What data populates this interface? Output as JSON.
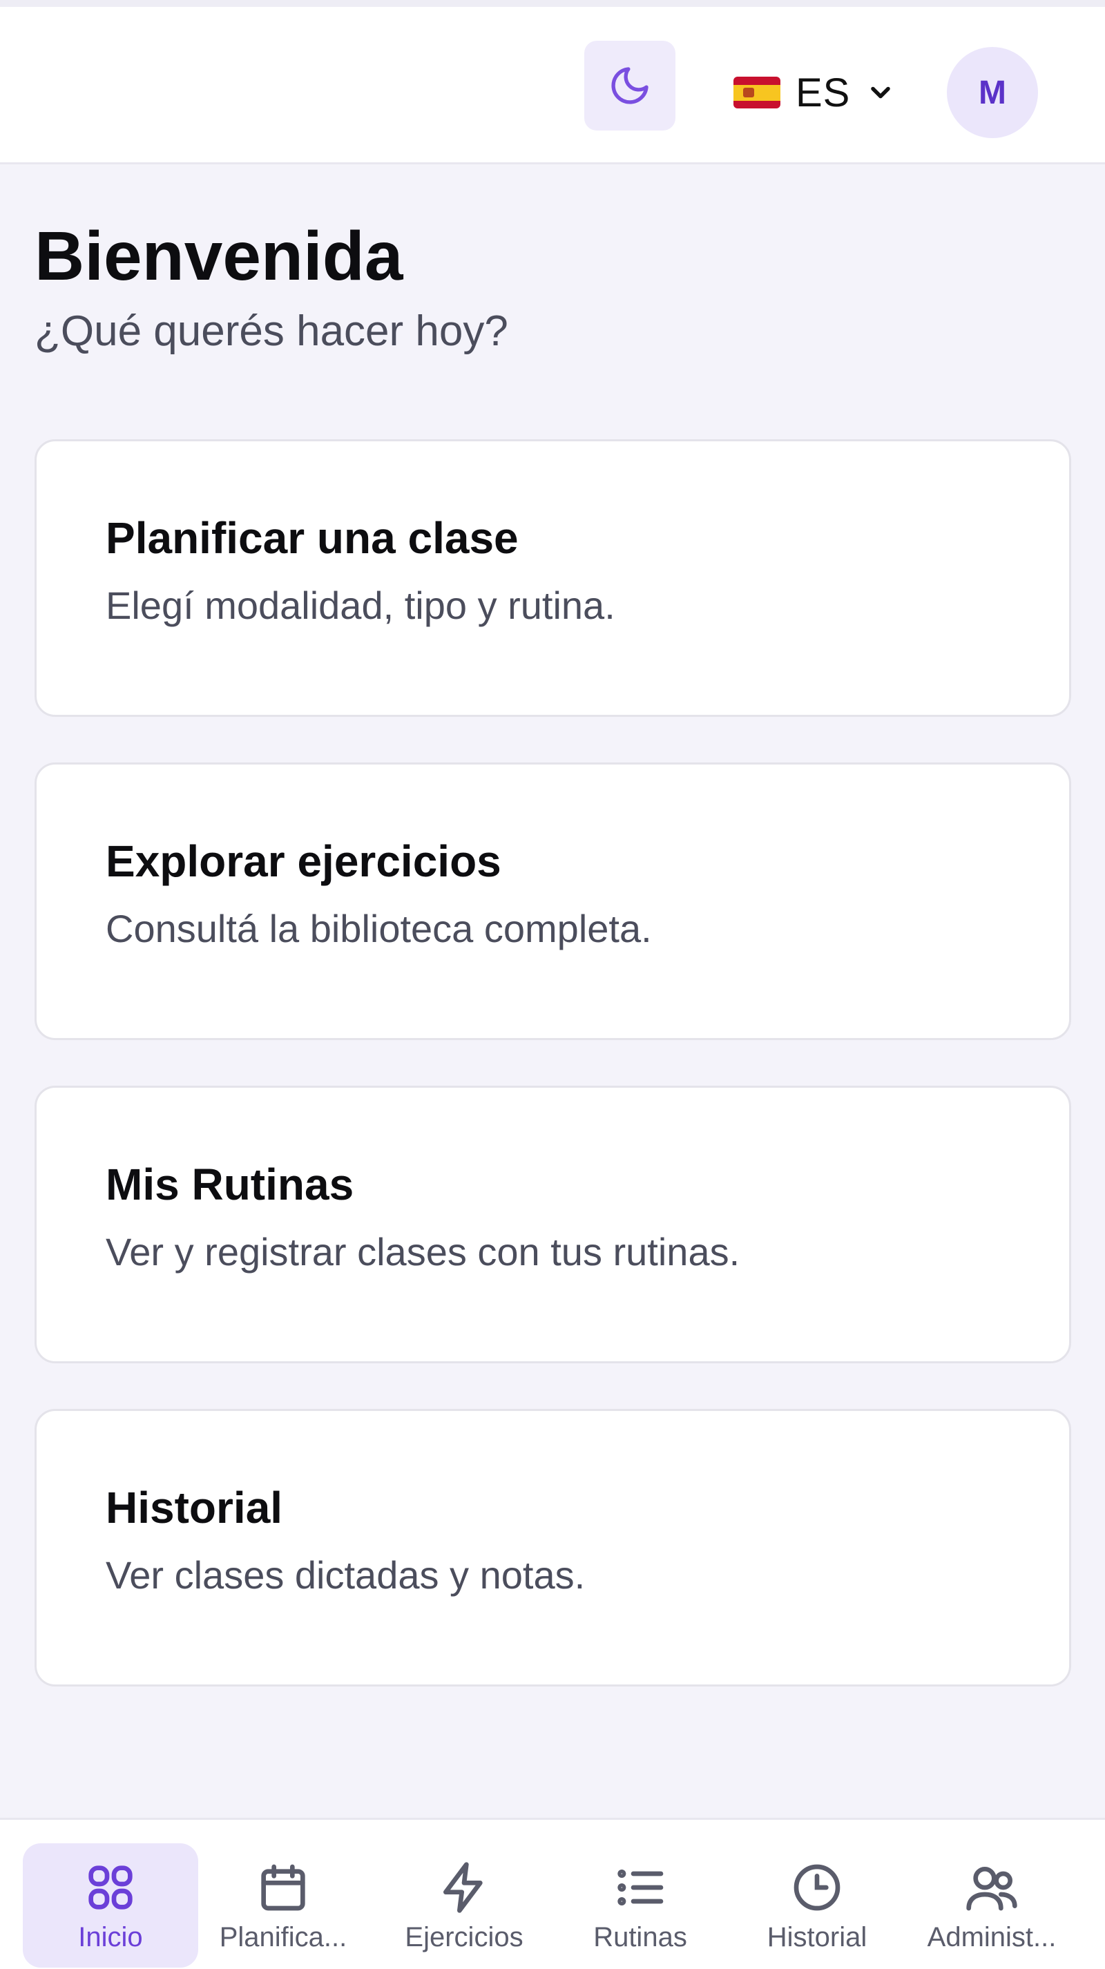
{
  "header": {
    "theme_toggle_icon": "moon-icon",
    "language": {
      "flag_icon": "spain-flag-icon",
      "code": "ES",
      "chevron_icon": "chevron-down-icon"
    },
    "avatar_initial": "M"
  },
  "greeting": {
    "title": "Bienvenida",
    "subtitle": "¿Qué querés hacer hoy?"
  },
  "cards": [
    {
      "title": "Planificar una clase",
      "description": "Elegí modalidad, tipo y rutina."
    },
    {
      "title": "Explorar ejercicios",
      "description": "Consultá la biblioteca completa."
    },
    {
      "title": "Mis Rutinas",
      "description": "Ver y registrar clases con tus rutinas."
    },
    {
      "title": "Historial",
      "description": "Ver clases dictadas y notas."
    }
  ],
  "bottom_nav": [
    {
      "label": "Inicio",
      "icon": "grid-icon",
      "active": true
    },
    {
      "label": "Planifica...",
      "icon": "calendar-icon",
      "active": false
    },
    {
      "label": "Ejercicios",
      "icon": "lightning-icon",
      "active": false
    },
    {
      "label": "Rutinas",
      "icon": "list-icon",
      "active": false
    },
    {
      "label": "Historial",
      "icon": "clock-icon",
      "active": false
    },
    {
      "label": "Administ...",
      "icon": "users-icon",
      "active": false
    }
  ],
  "colors": {
    "accent": "#6b3fd8",
    "background": "#f4f3fa",
    "active_tab_bg": "#ebe6fb"
  }
}
